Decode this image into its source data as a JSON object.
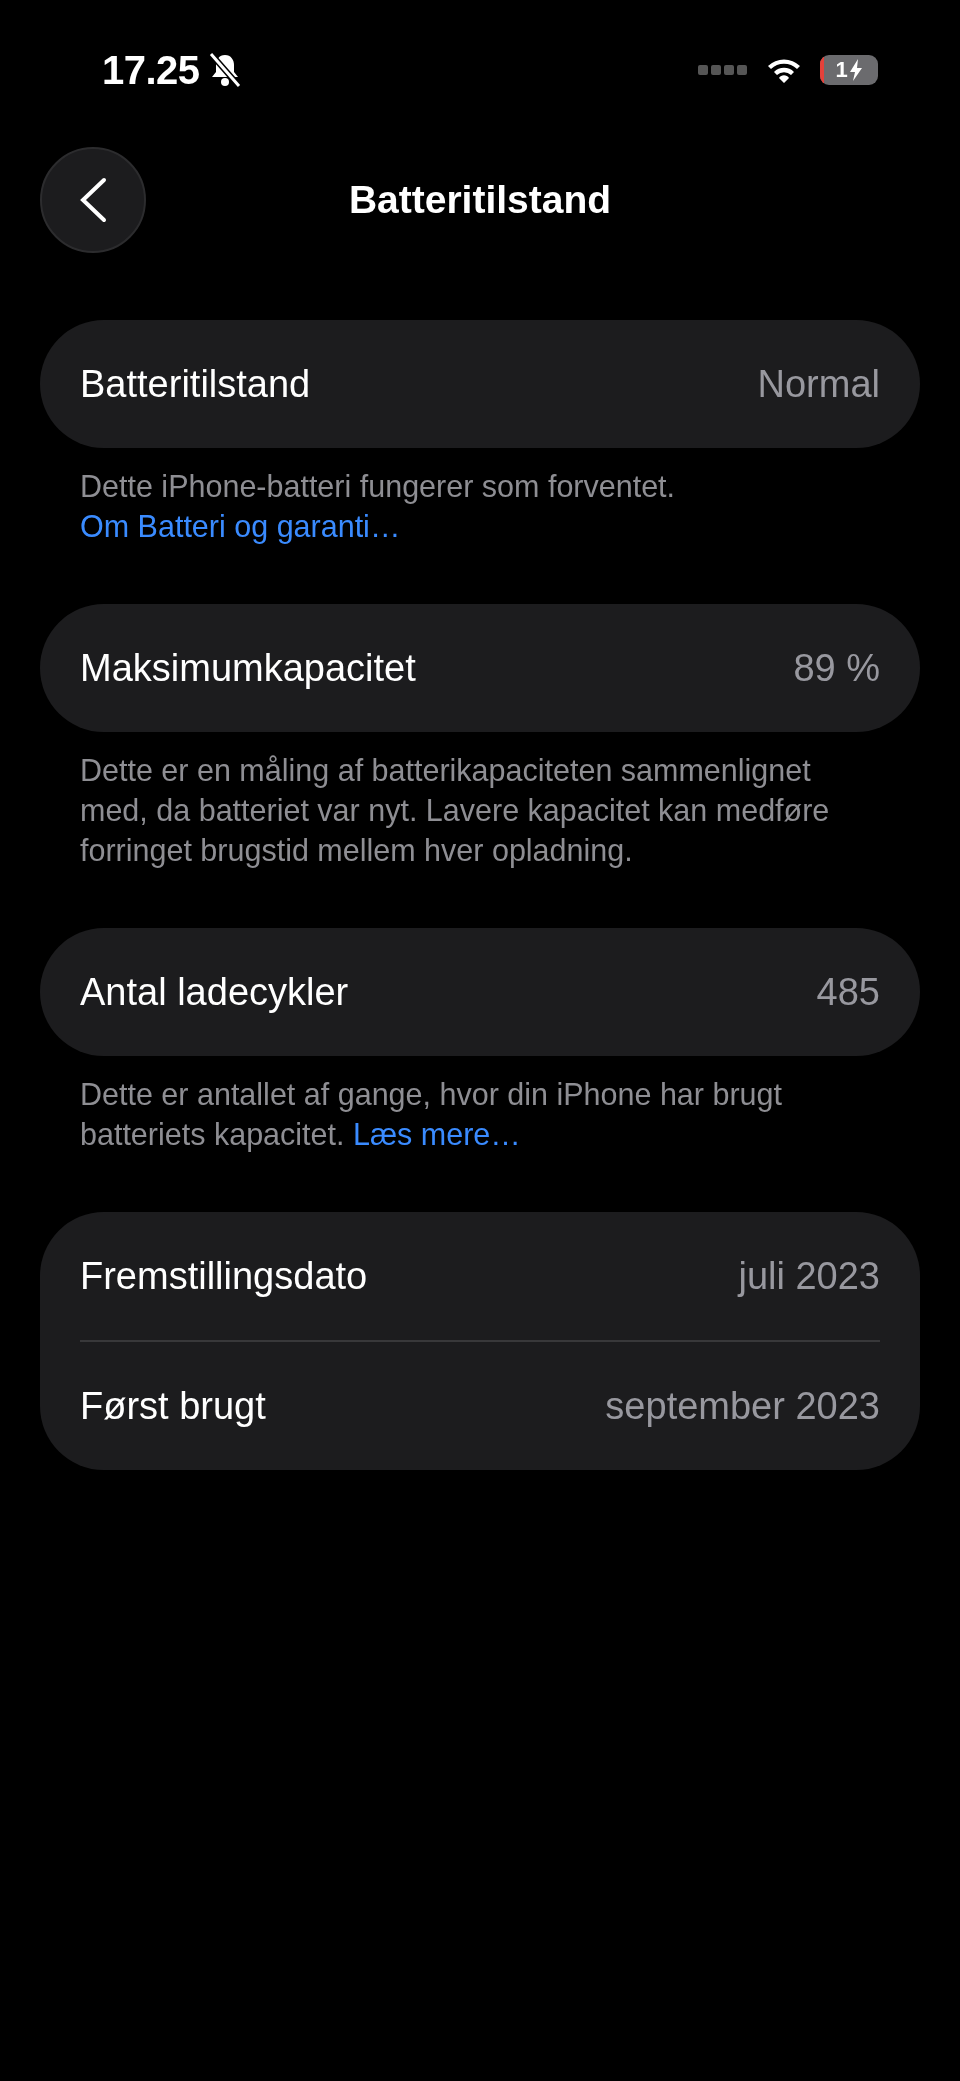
{
  "status_bar": {
    "time": "17.25",
    "silent": true,
    "battery_text": "1",
    "charging": true
  },
  "nav": {
    "title": "Batteritilstand"
  },
  "groups": [
    {
      "rows": [
        {
          "label": "Batteritilstand",
          "value": "Normal"
        }
      ],
      "footnote": {
        "text": "Dette iPhone-batteri fungerer som forventet.",
        "link": "Om Batteri og garanti…"
      }
    },
    {
      "rows": [
        {
          "label": "Maksimumkapacitet",
          "value": "89 %"
        }
      ],
      "footnote": {
        "text": "Dette er en måling af batterikapaciteten sammenlignet med, da batteriet var nyt. Lavere kapacitet kan medføre forringet brugstid mellem hver opladning."
      }
    },
    {
      "rows": [
        {
          "label": "Antal ladecykler",
          "value": "485"
        }
      ],
      "footnote": {
        "text": "Dette er antallet af gange, hvor din iPhone har brugt batteriets kapacitet.",
        "link": "Læs mere…"
      }
    },
    {
      "rows": [
        {
          "label": "Fremstillingsdato",
          "value": "juli 2023"
        },
        {
          "label": "Først brugt",
          "value": "september 2023"
        }
      ]
    }
  ]
}
